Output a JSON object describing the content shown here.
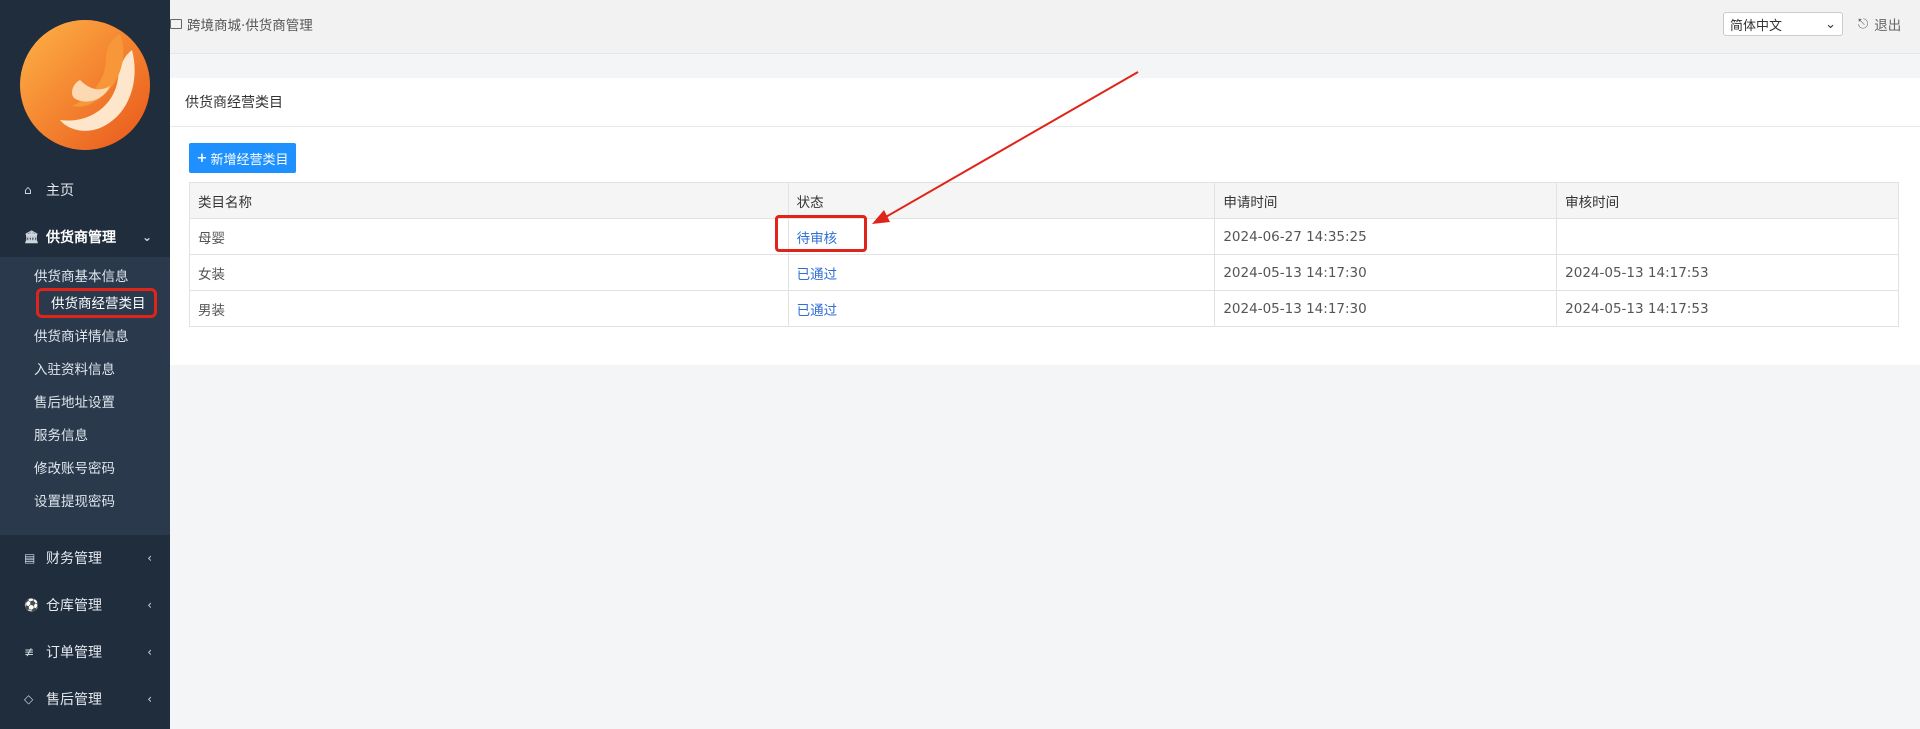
{
  "topbar": {
    "breadcrumb": "跨境商城·供货商管理",
    "language": "简体中文",
    "logout": "退出"
  },
  "sidebar": {
    "home": "主页",
    "supplier_mgmt": "供货商管理",
    "sub_items": [
      "供货商基本信息",
      "供货商经营类目",
      "供货商详情信息",
      "入驻资料信息",
      "售后地址设置",
      "服务信息",
      "修改账号密码",
      "设置提现密码"
    ],
    "finance": "财务管理",
    "warehouse": "仓库管理",
    "orders": "订单管理",
    "aftersale": "售后管理"
  },
  "main": {
    "card_title": "供货商经营类目",
    "add_button": "新增经营类目",
    "columns": [
      "类目名称",
      "状态",
      "申请时间",
      "审核时间"
    ],
    "rows": [
      [
        "母婴",
        "待审核",
        "2024-06-27 14:35:25",
        ""
      ],
      [
        "女装",
        "已通过",
        "2024-05-13 14:17:30",
        "2024-05-13 14:17:53"
      ],
      [
        "男装",
        "已通过",
        "2024-05-13 14:17:30",
        "2024-05-13 14:17:53"
      ]
    ]
  },
  "colors": {
    "sidebar_bg": "#1f2d3d",
    "accent_blue": "#1e90ff",
    "status_link": "#2f6fd6",
    "annotation_red": "#e0241a"
  }
}
